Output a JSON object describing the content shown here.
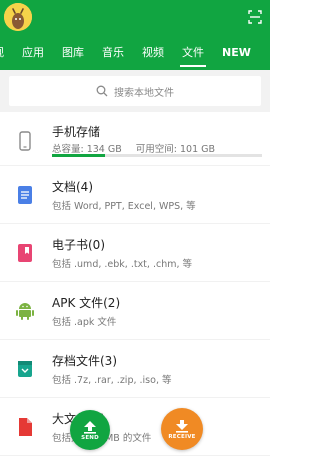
{
  "tabs": [
    "视",
    "应用",
    "图库",
    "音乐",
    "视频",
    "文件",
    "NEW"
  ],
  "active_tab_index": 5,
  "search": {
    "placeholder": "搜索本地文件"
  },
  "storage": {
    "title": "手机存储",
    "total": "总容量: 134 GB",
    "free": "可用空间: 101 GB",
    "used_fraction": 0.25
  },
  "items": [
    {
      "title": "文档(4)",
      "sub": "包括 Word, PPT, Excel, WPS, 等",
      "icon": "document-icon",
      "color": "#4a7fe6"
    },
    {
      "title": "电子书(0)",
      "sub": "包括 .umd, .ebk, .txt, .chm, 等",
      "icon": "ebook-icon",
      "color": "#e84573"
    },
    {
      "title": "APK 文件(2)",
      "sub": "包括 .apk 文件",
      "icon": "android-icon",
      "color": "#7cb342"
    },
    {
      "title": "存档文件(3)",
      "sub": "包括 .7z, .rar, .zip, .iso, 等",
      "icon": "archive-icon",
      "color": "#17a58e"
    },
    {
      "title": "大文件(3)",
      "sub": "包括大于50 MB 的文件",
      "icon": "large-file-icon",
      "color": "#e53935"
    }
  ],
  "actions": {
    "send": "SEND",
    "receive": "RECEIVE"
  }
}
